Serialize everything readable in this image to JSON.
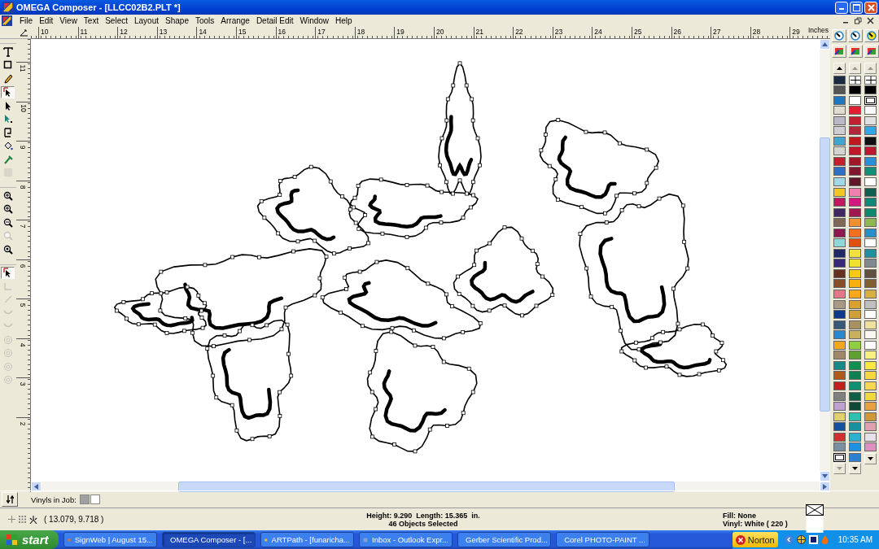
{
  "window": {
    "title": "OMEGA Composer - [LLCC02B2.PLT *]"
  },
  "menu": [
    "File",
    "Edit",
    "View",
    "Text",
    "Select",
    "Layout",
    "Shape",
    "Tools",
    "Arrange",
    "Detail Edit",
    "Window",
    "Help"
  ],
  "top_ruler": {
    "labels": [
      "10",
      "11",
      "12",
      "13",
      "14",
      "15",
      "16",
      "17",
      "18",
      "19",
      "20",
      "21",
      "22",
      "23",
      "24",
      "25",
      "26",
      "27",
      "28",
      "29"
    ],
    "unit": "Inches"
  },
  "left_ruler": {
    "labels": [
      "11",
      "10",
      "9",
      "8",
      "7",
      "6",
      "5",
      "4",
      "3",
      "2"
    ]
  },
  "tool_groups": [
    [
      {
        "kind": "text",
        "selected": false,
        "disabled": false
      },
      {
        "kind": "rectangle",
        "selected": false,
        "disabled": false
      },
      {
        "kind": "pencil",
        "selected": false,
        "disabled": false
      },
      {
        "kind": "node-arrow",
        "selected": true,
        "disabled": false
      },
      {
        "kind": "arrow",
        "selected": false,
        "disabled": false
      },
      {
        "kind": "edit-arrow",
        "selected": false,
        "disabled": false
      },
      {
        "kind": "trim",
        "selected": false,
        "disabled": false
      },
      {
        "kind": "bucket",
        "selected": false,
        "disabled": false
      },
      {
        "kind": "dropper",
        "selected": false,
        "disabled": false
      },
      {
        "kind": "grid",
        "selected": false,
        "disabled": true
      }
    ],
    [
      {
        "kind": "zoom-box",
        "selected": false,
        "disabled": false
      },
      {
        "kind": "zoom-in",
        "selected": false,
        "disabled": false
      },
      {
        "kind": "zoom-out",
        "selected": false,
        "disabled": false
      },
      {
        "kind": "zoom",
        "selected": false,
        "disabled": true
      },
      {
        "kind": "zoom-all",
        "selected": false,
        "disabled": false
      }
    ],
    [
      {
        "kind": "node-arrow",
        "selected": true,
        "disabled": false
      },
      {
        "kind": "node-edit",
        "selected": false,
        "disabled": true
      },
      {
        "kind": "line",
        "selected": false,
        "disabled": true
      },
      {
        "kind": "curve",
        "selected": false,
        "disabled": true
      },
      {
        "kind": "curve",
        "selected": false,
        "disabled": true
      },
      {
        "kind": "ring",
        "selected": false,
        "disabled": true
      },
      {
        "kind": "ring",
        "selected": false,
        "disabled": true
      },
      {
        "kind": "ring",
        "selected": false,
        "disabled": true
      },
      {
        "kind": "ring",
        "selected": false,
        "disabled": true
      }
    ]
  ],
  "palette": [
    [
      {
        "kind": "color",
        "color": "#1a2a40"
      },
      {
        "kind": "color",
        "color": "#555555"
      },
      {
        "kind": "color",
        "color": "#1e78c0"
      },
      {
        "kind": "color",
        "color": "#e0dcd0"
      },
      {
        "kind": "color",
        "color": "#b8b8c8"
      },
      {
        "kind": "color",
        "color": "#d0ccd4"
      },
      {
        "kind": "color",
        "color": "#40a8d0"
      },
      {
        "kind": "color",
        "color": "#d4d4d0"
      },
      {
        "kind": "color",
        "color": "#c02030"
      },
      {
        "kind": "color",
        "color": "#3070c0"
      },
      {
        "kind": "color",
        "color": "#a0d8e8"
      },
      {
        "kind": "color",
        "color": "#f0c820"
      },
      {
        "kind": "color",
        "color": "#c01860"
      },
      {
        "kind": "color",
        "color": "#402860"
      },
      {
        "kind": "color",
        "color": "#806858"
      },
      {
        "kind": "color",
        "color": "#901850"
      },
      {
        "kind": "color",
        "color": "#90d8d8"
      },
      {
        "kind": "color",
        "color": "#202868"
      },
      {
        "kind": "color",
        "color": "#382878"
      },
      {
        "kind": "color",
        "color": "#683020"
      },
      {
        "kind": "color",
        "color": "#885028"
      },
      {
        "kind": "color",
        "color": "#e07888"
      },
      {
        "kind": "color",
        "color": "#a89888"
      },
      {
        "kind": "color",
        "color": "#103888"
      },
      {
        "kind": "color",
        "color": "#385878"
      },
      {
        "kind": "color",
        "color": "#2888d0"
      },
      {
        "kind": "color",
        "color": "#f0a820"
      },
      {
        "kind": "color",
        "color": "#a08868"
      },
      {
        "kind": "color",
        "color": "#188888"
      },
      {
        "kind": "color",
        "color": "#b05818"
      },
      {
        "kind": "color",
        "color": "#c02020"
      },
      {
        "kind": "color",
        "color": "#808080"
      },
      {
        "kind": "color",
        "color": "#c0a0d0"
      },
      {
        "kind": "color",
        "color": "#e0d070"
      },
      {
        "kind": "color",
        "color": "#1850a0"
      },
      {
        "kind": "color",
        "color": "#d03030"
      },
      {
        "kind": "color",
        "color": "#7890a0"
      },
      {
        "kind": "current",
        "color": "#ffffff"
      }
    ],
    [
      {
        "kind": "none",
        "color": "#ffffff"
      },
      {
        "kind": "color",
        "color": "#000000"
      },
      {
        "kind": "color",
        "color": "#ffffff"
      },
      {
        "kind": "color",
        "color": "#e02030"
      },
      {
        "kind": "color",
        "color": "#c02030"
      },
      {
        "kind": "color",
        "color": "#b02838"
      },
      {
        "kind": "color",
        "color": "#c01820"
      },
      {
        "kind": "color",
        "color": "#c01828"
      },
      {
        "kind": "color",
        "color": "#a01828"
      },
      {
        "kind": "color",
        "color": "#801830"
      },
      {
        "kind": "color",
        "color": "#601828"
      },
      {
        "kind": "color",
        "color": "#f080b0"
      },
      {
        "kind": "color",
        "color": "#d01880"
      },
      {
        "kind": "color",
        "color": "#a01850"
      },
      {
        "kind": "color",
        "color": "#f09030"
      },
      {
        "kind": "color",
        "color": "#f07020"
      },
      {
        "kind": "color",
        "color": "#e05010"
      },
      {
        "kind": "color",
        "color": "#f0e040"
      },
      {
        "kind": "color",
        "color": "#f0e030"
      },
      {
        "kind": "color",
        "color": "#f8c818"
      },
      {
        "kind": "color",
        "color": "#f8b010"
      },
      {
        "kind": "color",
        "color": "#f8a818"
      },
      {
        "kind": "color",
        "color": "#d8a030"
      },
      {
        "kind": "color",
        "color": "#d0a038"
      },
      {
        "kind": "color",
        "color": "#a89060"
      },
      {
        "kind": "color",
        "color": "#c8b060"
      },
      {
        "kind": "color",
        "color": "#90d040"
      },
      {
        "kind": "color",
        "color": "#60a030"
      },
      {
        "kind": "color",
        "color": "#109050"
      },
      {
        "kind": "color",
        "color": "#108050"
      },
      {
        "kind": "color",
        "color": "#109070"
      },
      {
        "kind": "color",
        "color": "#106048"
      },
      {
        "kind": "color",
        "color": "#104838"
      },
      {
        "kind": "color",
        "color": "#30c0b0"
      },
      {
        "kind": "color",
        "color": "#1890a0"
      },
      {
        "kind": "color",
        "color": "#30b0d0"
      },
      {
        "kind": "color",
        "color": "#2090e0"
      },
      {
        "kind": "color",
        "color": "#3080d0"
      }
    ],
    [
      {
        "kind": "none",
        "color": "#ffffff"
      },
      {
        "kind": "color",
        "color": "#000000"
      },
      {
        "kind": "current",
        "color": "#ffffff"
      },
      {
        "kind": "color",
        "color": "#f8f8f8"
      },
      {
        "kind": "color",
        "color": "#e0e0e0"
      },
      {
        "kind": "color",
        "color": "#30a8e8"
      },
      {
        "kind": "color",
        "color": "#101010"
      },
      {
        "kind": "color",
        "color": "#c01830"
      },
      {
        "kind": "color",
        "color": "#2890d8"
      },
      {
        "kind": "color",
        "color": "#109078"
      },
      {
        "kind": "color",
        "color": "#fefefe"
      },
      {
        "kind": "color",
        "color": "#106050"
      },
      {
        "kind": "color",
        "color": "#108878"
      },
      {
        "kind": "color",
        "color": "#108870"
      },
      {
        "kind": "color",
        "color": "#90b850"
      },
      {
        "kind": "color",
        "color": "#2890c8"
      },
      {
        "kind": "color",
        "color": "#fdfdfd"
      },
      {
        "kind": "color",
        "color": "#2090a0"
      },
      {
        "kind": "color",
        "color": "#808890"
      },
      {
        "kind": "color",
        "color": "#605040"
      },
      {
        "kind": "color",
        "color": "#806030"
      },
      {
        "kind": "color",
        "color": "#d8b040"
      },
      {
        "kind": "color",
        "color": "#c0c0c0"
      },
      {
        "kind": "color",
        "color": "#fcfcfc"
      },
      {
        "kind": "color",
        "color": "#f0e0a0"
      },
      {
        "kind": "color",
        "color": "#f8f8f0"
      },
      {
        "kind": "color",
        "color": "#fbfbfb"
      },
      {
        "kind": "color",
        "color": "#f8f080"
      },
      {
        "kind": "color",
        "color": "#f8e840"
      },
      {
        "kind": "color",
        "color": "#f8d840"
      },
      {
        "kind": "color",
        "color": "#f8d850"
      },
      {
        "kind": "color",
        "color": "#f0d840"
      },
      {
        "kind": "color",
        "color": "#e8a040"
      },
      {
        "kind": "color",
        "color": "#d09838"
      },
      {
        "kind": "color",
        "color": "#e0a0b0"
      },
      {
        "kind": "color",
        "color": "#e8e0e8"
      },
      {
        "kind": "color",
        "color": "#e090c0"
      }
    ]
  ],
  "vinyl_bar": {
    "label": "Vinyls in Job:",
    "swatches": [
      {
        "color": "#a0a0a0"
      },
      {
        "color": "#ffffff"
      }
    ]
  },
  "status_bar": {
    "coordinates": "( 13.079, 9.718 )",
    "dimensions": "Height: 9.290  Length: 15.365  in.",
    "selection": "46 Objects Selected",
    "fill": "Fill: None",
    "vinyl": "Vinyl: White ( 220 )"
  },
  "taskbar": {
    "start": "start",
    "tasks": [
      {
        "label": "SignWeb | August 15...",
        "selected": false
      },
      {
        "label": "OMEGA Composer - [...",
        "selected": true
      },
      {
        "label": "ARTPath - [funaricha...",
        "selected": false
      },
      {
        "label": "Inbox - Outlook Expr...",
        "selected": false
      },
      {
        "label": "Gerber Scientific Prod...",
        "selected": false
      },
      {
        "label": "Corel PHOTO-PAINT ...",
        "selected": false
      }
    ],
    "norton": "Norton",
    "clock": "10:35 AM"
  }
}
